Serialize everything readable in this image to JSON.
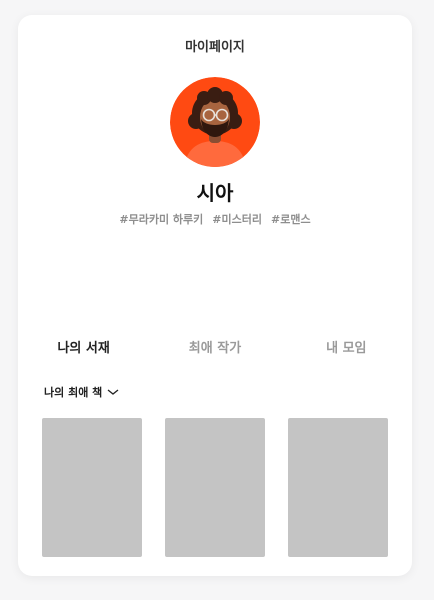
{
  "header": {
    "title": "마이페이지"
  },
  "profile": {
    "nickname": "시아",
    "avatar_icon": "user-avatar-icon",
    "avatar_bg": "#ff4a12",
    "tags": [
      "#무라카미 하루키",
      "#미스터리",
      "#로맨스"
    ]
  },
  "tabs": [
    {
      "label": "나의 서재",
      "active": true
    },
    {
      "label": "최애 작가",
      "active": false
    },
    {
      "label": "내 모임",
      "active": false
    }
  ],
  "shelf": {
    "selector_label": "나의 최애 책",
    "dropdown_icon": "chevron-down-icon",
    "book_placeholder_color": "#c4c4c4",
    "book_count": 3
  }
}
